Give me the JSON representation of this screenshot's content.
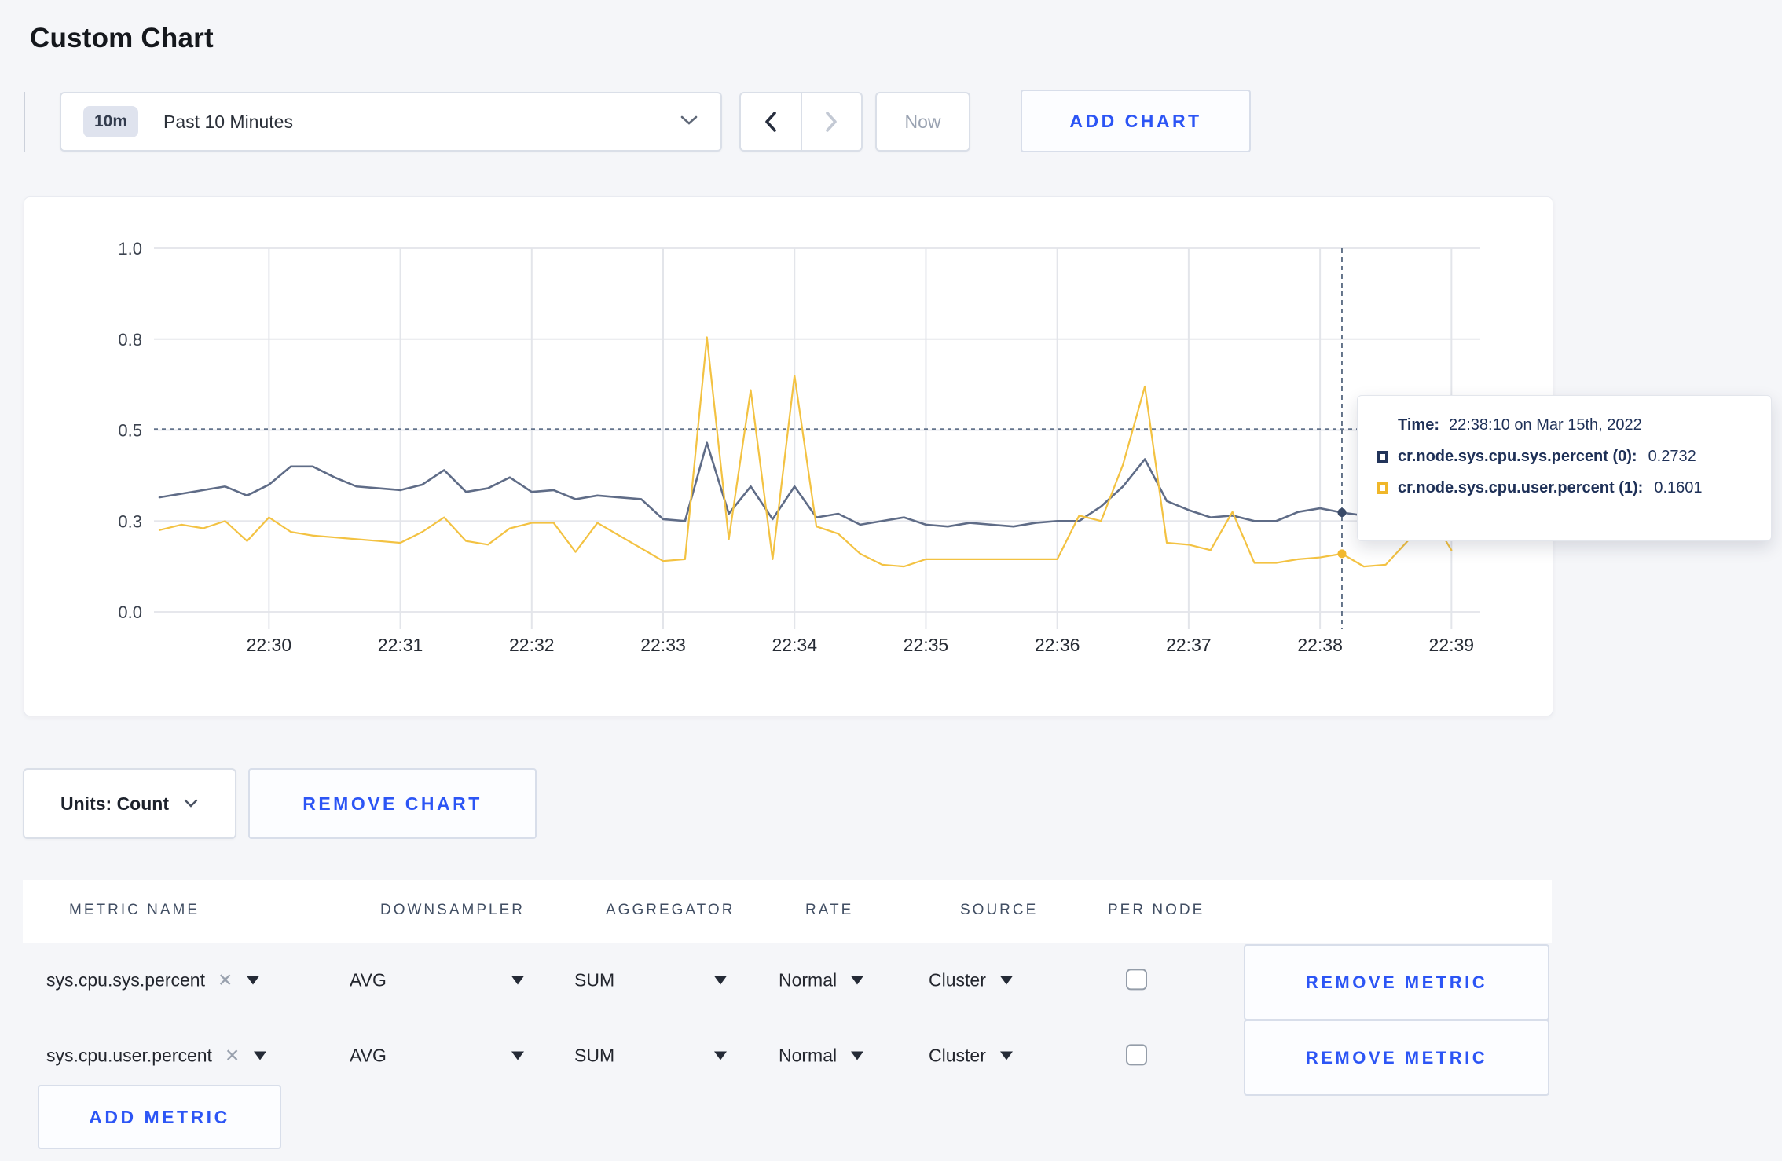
{
  "page": {
    "title": "Custom Chart"
  },
  "toolbar": {
    "time_range": {
      "badge": "10m",
      "label": "Past 10 Minutes"
    },
    "prev_icon": "chevron-left",
    "next_icon": "chevron-right",
    "now_label": "Now",
    "add_chart_label": "ADD CHART"
  },
  "chart_controls": {
    "units_label": "Units: Count",
    "remove_chart_label": "REMOVE CHART"
  },
  "tooltip": {
    "time_label": "Time:",
    "time_value": "22:38:10 on Mar 15th, 2022",
    "series": [
      {
        "name": "cr.node.sys.cpu.sys.percent (0):",
        "value": "0.2732",
        "color": "#22345a"
      },
      {
        "name": "cr.node.sys.cpu.user.percent (1):",
        "value": "0.1601",
        "color": "#f0b72a"
      }
    ]
  },
  "metrics_table": {
    "headers": [
      "METRIC NAME",
      "DOWNSAMPLER",
      "AGGREGATOR",
      "RATE",
      "SOURCE",
      "PER NODE"
    ],
    "rows": [
      {
        "metric": "sys.cpu.sys.percent",
        "downsampler": "AVG",
        "aggregator": "SUM",
        "rate": "Normal",
        "source": "Cluster",
        "per_node_checked": false,
        "remove_label": "REMOVE METRIC"
      },
      {
        "metric": "sys.cpu.user.percent",
        "downsampler": "AVG",
        "aggregator": "SUM",
        "rate": "Normal",
        "source": "Cluster",
        "per_node_checked": false,
        "remove_label": "REMOVE METRIC"
      }
    ],
    "add_metric_label": "ADD METRIC"
  },
  "colors": {
    "accent_blue": "#2c55f5",
    "page_background": "#f5f6f9",
    "grid_line": "#e6e7ec",
    "crosshair": "#546078"
  },
  "chart_data": {
    "type": "line",
    "title": "",
    "xlabel": "",
    "ylabel": "",
    "ylim": [
      0,
      1
    ],
    "grid": true,
    "legend_position": "tooltip",
    "x_tick_labels": [
      "22:30",
      "22:31",
      "22:32",
      "22:33",
      "22:34",
      "22:35",
      "22:36",
      "22:37",
      "22:38",
      "22:39"
    ],
    "y_tick_labels": [
      "0.0",
      "0.3",
      "0.5",
      "0.8",
      "1.0"
    ],
    "y_tick_values": [
      0,
      0.25,
      0.5,
      0.75,
      1.0
    ],
    "time_start": "22:29:10",
    "time_step_seconds": 10,
    "series": [
      {
        "name": "cr.node.sys.cpu.sys.percent (0)",
        "color": "#5f6c87",
        "dot_color": "#3a4a68",
        "width": 2.6,
        "values": [
          0.315,
          0.325,
          0.335,
          0.345,
          0.32,
          0.35,
          0.4,
          0.4,
          0.37,
          0.345,
          0.34,
          0.335,
          0.35,
          0.39,
          0.33,
          0.34,
          0.37,
          0.33,
          0.335,
          0.31,
          0.32,
          0.315,
          0.31,
          0.255,
          0.25,
          0.465,
          0.27,
          0.345,
          0.255,
          0.345,
          0.26,
          0.27,
          0.24,
          0.25,
          0.26,
          0.24,
          0.235,
          0.245,
          0.24,
          0.235,
          0.245,
          0.25,
          0.25,
          0.29,
          0.345,
          0.42,
          0.305,
          0.28,
          0.26,
          0.265,
          0.25,
          0.25,
          0.275,
          0.285,
          0.2732,
          0.265,
          0.27,
          0.275,
          0.285,
          0.29
        ]
      },
      {
        "name": "cr.node.sys.cpu.user.percent (1)",
        "color": "#f3c242",
        "dot_color": "#f2b82d",
        "width": 2.2,
        "values": [
          0.225,
          0.24,
          0.23,
          0.25,
          0.195,
          0.26,
          0.22,
          0.21,
          0.205,
          0.2,
          0.195,
          0.19,
          0.22,
          0.26,
          0.195,
          0.185,
          0.23,
          0.245,
          0.245,
          0.165,
          0.245,
          0.21,
          0.175,
          0.14,
          0.145,
          0.755,
          0.2,
          0.61,
          0.145,
          0.65,
          0.235,
          0.215,
          0.16,
          0.13,
          0.125,
          0.145,
          0.145,
          0.145,
          0.145,
          0.145,
          0.145,
          0.145,
          0.265,
          0.25,
          0.405,
          0.62,
          0.19,
          0.185,
          0.17,
          0.275,
          0.135,
          0.135,
          0.145,
          0.15,
          0.1601,
          0.125,
          0.13,
          0.195,
          0.27,
          0.17
        ]
      }
    ],
    "crosshair": {
      "time": "22:38:10",
      "index": 54,
      "y_value": 0.503,
      "values": {
        "cr.node.sys.cpu.sys.percent (0)": 0.2732,
        "cr.node.sys.cpu.user.percent (1)": 0.1601
      }
    }
  }
}
